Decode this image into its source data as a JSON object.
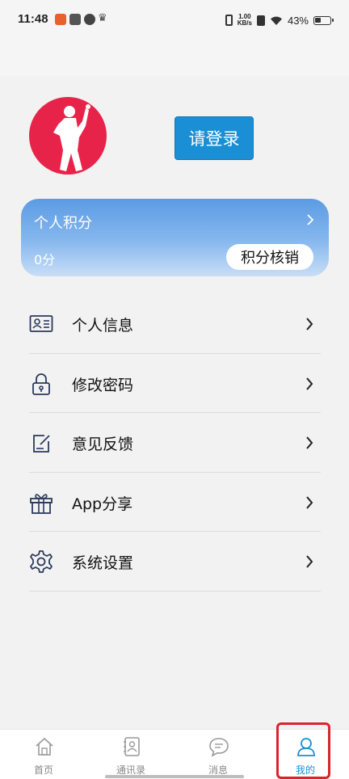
{
  "status_bar": {
    "time": "11:48",
    "net_speed_value": "1.00",
    "net_speed_unit": "KB/s",
    "battery": "43%",
    "battery_level": 0.43
  },
  "profile": {
    "login_label": "请登录"
  },
  "points_card": {
    "title": "个人积分",
    "value": "0分",
    "redeem_label": "积分核销"
  },
  "menu": {
    "items": [
      {
        "label": "个人信息",
        "icon": "id-card-icon"
      },
      {
        "label": "修改密码",
        "icon": "lock-icon"
      },
      {
        "label": "意见反馈",
        "icon": "edit-icon"
      },
      {
        "label": "App分享",
        "icon": "gift-icon"
      },
      {
        "label": "系统设置",
        "icon": "gear-icon"
      }
    ]
  },
  "tab_bar": {
    "tabs": [
      {
        "label": "首页",
        "icon": "home-icon"
      },
      {
        "label": "通讯录",
        "icon": "contacts-icon"
      },
      {
        "label": "消息",
        "icon": "message-icon"
      },
      {
        "label": "我的",
        "icon": "user-icon",
        "active": true
      }
    ]
  },
  "colors": {
    "accent": "#1a8fd6",
    "avatar_bg": "#e8234a",
    "highlight": "#d9232e"
  }
}
